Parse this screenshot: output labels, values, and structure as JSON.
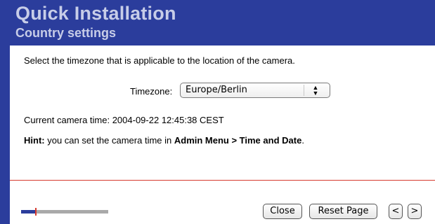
{
  "header": {
    "title": "Quick Installation",
    "subtitle": "Country settings"
  },
  "main": {
    "intro": "Select the timezone that is applicable to the location of the camera.",
    "timezone": {
      "label": "Timezone:",
      "selected": "Europe/Berlin",
      "arrows_icon": "up-down-arrows-icon"
    },
    "current_time": "Current camera time: 2004-09-22 12:45:38 CEST",
    "hint": {
      "prefix": "Hint:",
      "text": " you can set the camera time in ",
      "location": "Admin Menu > Time and Date",
      "suffix": "."
    }
  },
  "footer": {
    "progress": {
      "fraction": 0.17
    },
    "buttons": {
      "close": "Close",
      "reset": "Reset Page",
      "prev": "<",
      "next": ">"
    }
  },
  "colors": {
    "brand_blue": "#2b3d9c",
    "header_text": "#c7cde8",
    "accent_red": "#d63a2f",
    "progress_track": "#a9a9a9"
  }
}
